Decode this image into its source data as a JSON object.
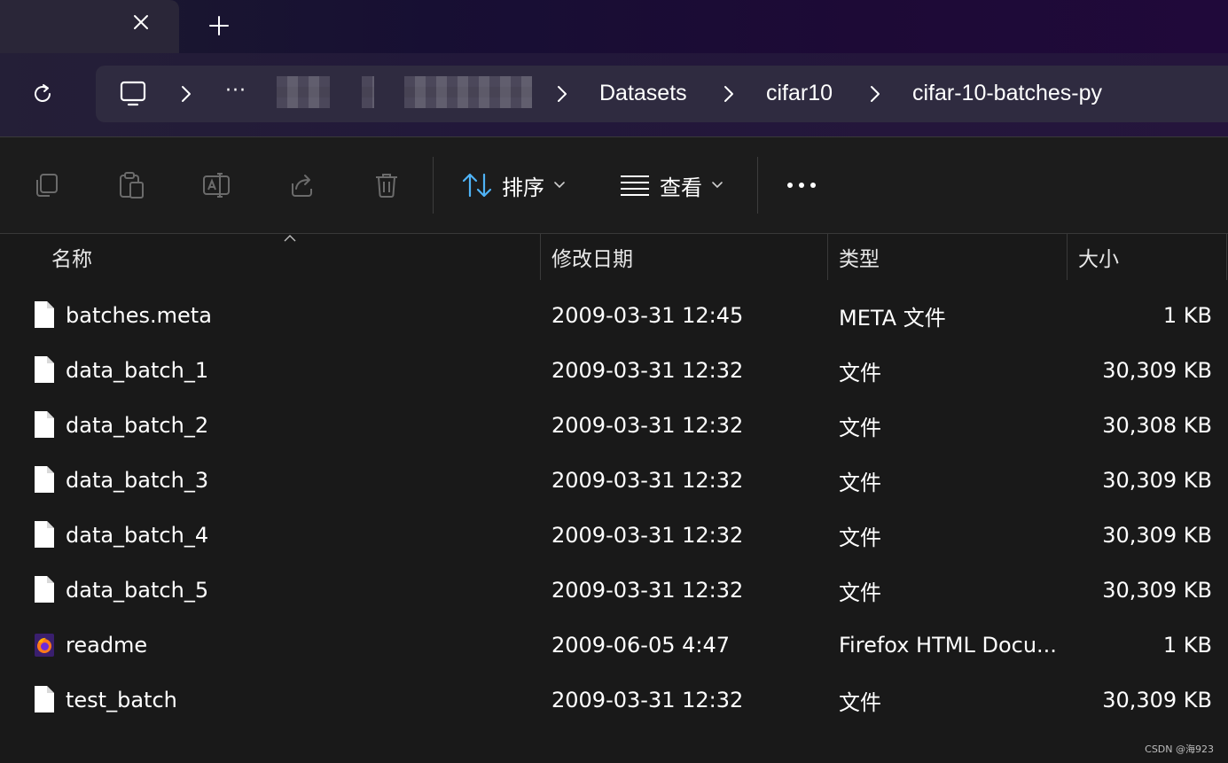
{
  "tab": {
    "close_icon": "close-icon",
    "new_tab_icon": "plus-icon"
  },
  "nav": {
    "refresh_icon": "refresh-icon",
    "breadcrumb": {
      "root_icon": "this-pc-icon",
      "more": "···",
      "items": [
        "Datasets",
        "cifar10",
        "cifar-10-batches-py"
      ]
    }
  },
  "toolbar": {
    "sort_label": "排序",
    "view_label": "查看",
    "more_icon": "more-icon"
  },
  "columns": {
    "name": "名称",
    "date": "修改日期",
    "type": "类型",
    "size": "大小"
  },
  "files": [
    {
      "name": "batches.meta",
      "date": "2009-03-31 12:45",
      "type": "META 文件",
      "size": "1 KB",
      "icon": "file-icon"
    },
    {
      "name": "data_batch_1",
      "date": "2009-03-31 12:32",
      "type": "文件",
      "size": "30,309 KB",
      "icon": "file-icon"
    },
    {
      "name": "data_batch_2",
      "date": "2009-03-31 12:32",
      "type": "文件",
      "size": "30,308 KB",
      "icon": "file-icon"
    },
    {
      "name": "data_batch_3",
      "date": "2009-03-31 12:32",
      "type": "文件",
      "size": "30,309 KB",
      "icon": "file-icon"
    },
    {
      "name": "data_batch_4",
      "date": "2009-03-31 12:32",
      "type": "文件",
      "size": "30,309 KB",
      "icon": "file-icon"
    },
    {
      "name": "data_batch_5",
      "date": "2009-03-31 12:32",
      "type": "文件",
      "size": "30,309 KB",
      "icon": "file-icon"
    },
    {
      "name": "readme",
      "date": "2009-06-05 4:47",
      "type": "Firefox HTML Docu...",
      "size": "1 KB",
      "icon": "firefox-icon"
    },
    {
      "name": "test_batch",
      "date": "2009-03-31 12:32",
      "type": "文件",
      "size": "30,309 KB",
      "icon": "file-icon"
    }
  ],
  "watermark": "CSDN @海923"
}
